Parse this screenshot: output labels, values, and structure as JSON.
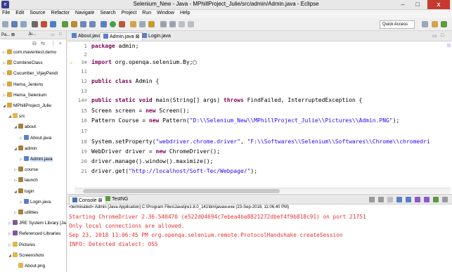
{
  "window": {
    "title": "Selenium_New - Java - MPhillProject_Julie/src/admin/Admin.java - Eclipse",
    "minimize": "–",
    "maximize": "□",
    "close": "x"
  },
  "menu": [
    "File",
    "Edit",
    "Source",
    "Refactor",
    "Navigate",
    "Search",
    "Project",
    "Run",
    "Window",
    "Help"
  ],
  "toolbar": {
    "quick_access": "Quick Access"
  },
  "package_explorer": {
    "tab_label": "Pa... ⊠",
    "tab_junit": "Ju...",
    "items": [
      {
        "label": "com.maventest.demo",
        "toggle": "▷",
        "icon": "project-icon"
      },
      {
        "label": "CombineClass",
        "toggle": "▷",
        "icon": "project-icon"
      },
      {
        "label": "Cucumber_VijayPandi",
        "toggle": "▷",
        "icon": "project-icon"
      },
      {
        "label": "Hema_Jenkins",
        "toggle": "▷",
        "icon": "project-icon"
      },
      {
        "label": "Hema_Selenium",
        "toggle": "▷",
        "icon": "project-icon"
      },
      {
        "label": "MPhillProject_Julie",
        "toggle": "◢",
        "icon": "project-icon"
      },
      {
        "label": "src",
        "toggle": "◢",
        "icon": "folder-icon"
      },
      {
        "label": "about",
        "toggle": "◢",
        "icon": "package-icon"
      },
      {
        "label": "About.java",
        "toggle": "▷",
        "icon": "java-file-icon"
      },
      {
        "label": "admin",
        "toggle": "◢",
        "icon": "package-icon"
      },
      {
        "label": "Admin.java",
        "toggle": "▷",
        "icon": "java-file-icon"
      },
      {
        "label": "course",
        "toggle": "▷",
        "icon": "package-icon"
      },
      {
        "label": "launch",
        "toggle": "▷",
        "icon": "package-icon"
      },
      {
        "label": "login",
        "toggle": "◢",
        "icon": "package-icon"
      },
      {
        "label": "Login.java",
        "toggle": "▷",
        "icon": "java-file-icon"
      },
      {
        "label": "utilities",
        "toggle": "▷",
        "icon": "package-icon"
      },
      {
        "label": "JRE System Library [Java",
        "toggle": "▷",
        "icon": "library-icon"
      },
      {
        "label": "Referenced Libraries",
        "toggle": "▷",
        "icon": "library-icon"
      },
      {
        "label": "Pictures",
        "toggle": "▷",
        "icon": "folder-icon"
      },
      {
        "label": "Screenshots",
        "toggle": "◢",
        "icon": "folder-icon"
      },
      {
        "label": "About.png",
        "toggle": "",
        "icon": "image-file-icon"
      }
    ]
  },
  "editor": {
    "tabs": [
      {
        "label": "About.java",
        "active": false
      },
      {
        "label": "Admin.java ⊠",
        "active": true
      },
      {
        "label": "Login.java",
        "active": false
      }
    ],
    "lines": [
      {
        "num": "1",
        "text": "package admin;"
      },
      {
        "num": "2",
        "text": ""
      },
      {
        "num": "3⊕",
        "text": "import org.openqa.selenium.By;▢"
      },
      {
        "num": "11",
        "text": ""
      },
      {
        "num": "12",
        "text": "public class Admin {"
      },
      {
        "num": "13",
        "text": ""
      },
      {
        "num": "14⊖",
        "text": "    public static void main(String[] args) throws FindFailed, InterruptedException {"
      },
      {
        "num": "15",
        "text": "        Screen screen = new Screen();"
      },
      {
        "num": "16",
        "text": "        Pattern Course = new Pattern(\"D:\\\\Selenium_New\\\\MPhillProject_Julie\\\\Pictures\\\\Admin.PNG\");"
      },
      {
        "num": "17",
        "text": ""
      },
      {
        "num": "18",
        "text": "        System.setProperty(\"webdriver.chrome.driver\", \"F:\\\\Softwares\\\\Selenium\\\\Softwares\\\\Chrome\\\\chromedri"
      },
      {
        "num": "19",
        "text": "        WebDriver driver = new ChromeDriver();"
      },
      {
        "num": "20",
        "text": "        driver.manage().window().maximize();"
      },
      {
        "num": "21",
        "text": "        driver.get(\"http://localhost/Soft-Tec/Webpage/\");"
      }
    ]
  },
  "console": {
    "tab_console": "Console ⊠",
    "tab_testng": "TestNG",
    "header": "<terminated> Admin [Java Application] C:\\Program Files\\Java\\jre1.8.0_141\\bin\\javaw.exe (23-Sep-2018, 11:06:40 PM)",
    "lines": [
      "Starting ChromeDriver 2.36.540470 (e522d04694c7ebea4ba8821272dbef4f9b818c91) on port 21751",
      "Only local connections are allowed.",
      "Sep 23, 2018 11:06:45 PM org.openqa.selenium.remote.ProtocolHandshake createSession",
      "INFO: Detected dialect: OSS"
    ]
  },
  "colors": {
    "keyword": "#7f0055",
    "string": "#2a00ff",
    "console_error": "#e6322d",
    "close_button": "#c7382d"
  }
}
